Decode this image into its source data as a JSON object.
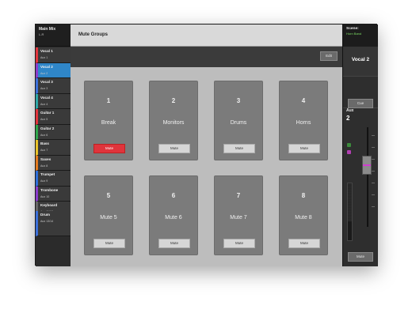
{
  "sidebar": {
    "main_mix": {
      "title": "Main Mix",
      "sub": "L-R"
    },
    "channels": [
      {
        "name": "Vocal 1",
        "sub": "Aux 1",
        "color": "#e0343c"
      },
      {
        "name": "Vocal 2",
        "sub": "Aux 2",
        "color": "#8a3bcb",
        "active": true
      },
      {
        "name": "Vocal 3",
        "sub": "Aux 3",
        "color": "#3b6fd8"
      },
      {
        "name": "Vocal 4",
        "sub": "Aux 4",
        "color": "#2ea6a6"
      },
      {
        "name": "Guitar 1",
        "sub": "Aux 5",
        "color": "#e0343c"
      },
      {
        "name": "Guitar 2",
        "sub": "Aux 6",
        "color": "#2ea64a"
      },
      {
        "name": "Bass",
        "sub": "Aux 7",
        "color": "#e8c22a"
      },
      {
        "name": "Saxes",
        "sub": "Aux 8",
        "color": "#e27a1f"
      },
      {
        "name": "Trumpet",
        "sub": "Aux 9",
        "color": "#2e6ed8"
      },
      {
        "name": "Trombone",
        "sub": "Aux 10",
        "color": "#8a3bcb"
      },
      {
        "name": "Keyboard",
        "sub": "Aux 11/12",
        "color": "#666666"
      }
    ],
    "drum": {
      "name": "Drum",
      "sub": "Aux 13/14",
      "color": "#3b6fd8"
    }
  },
  "header": {
    "title": "Mute Groups"
  },
  "toolbar": {
    "edit_label": "Edit"
  },
  "groups": [
    {
      "num": "1",
      "name": "Break",
      "mute_label": "Mute",
      "muted": true
    },
    {
      "num": "2",
      "name": "Monitors",
      "mute_label": "Mute",
      "muted": false
    },
    {
      "num": "3",
      "name": "Drums",
      "mute_label": "Mute",
      "muted": false
    },
    {
      "num": "4",
      "name": "Horns",
      "mute_label": "Mute",
      "muted": false
    },
    {
      "num": "5",
      "name": "Mute 5",
      "mute_label": "Mute",
      "muted": false
    },
    {
      "num": "6",
      "name": "Mute 6",
      "mute_label": "Mute",
      "muted": false
    },
    {
      "num": "7",
      "name": "Mute 7",
      "mute_label": "Mute",
      "muted": false
    },
    {
      "num": "8",
      "name": "Mute 8",
      "mute_label": "Mute",
      "muted": false
    }
  ],
  "right": {
    "scene_label": "Scene:",
    "scene_name": "Horn Band",
    "strip_name": "Vocal 2",
    "cue_label": "Cue",
    "aux_label": "Aux",
    "aux_value": "2",
    "mute_label": "Mute"
  }
}
